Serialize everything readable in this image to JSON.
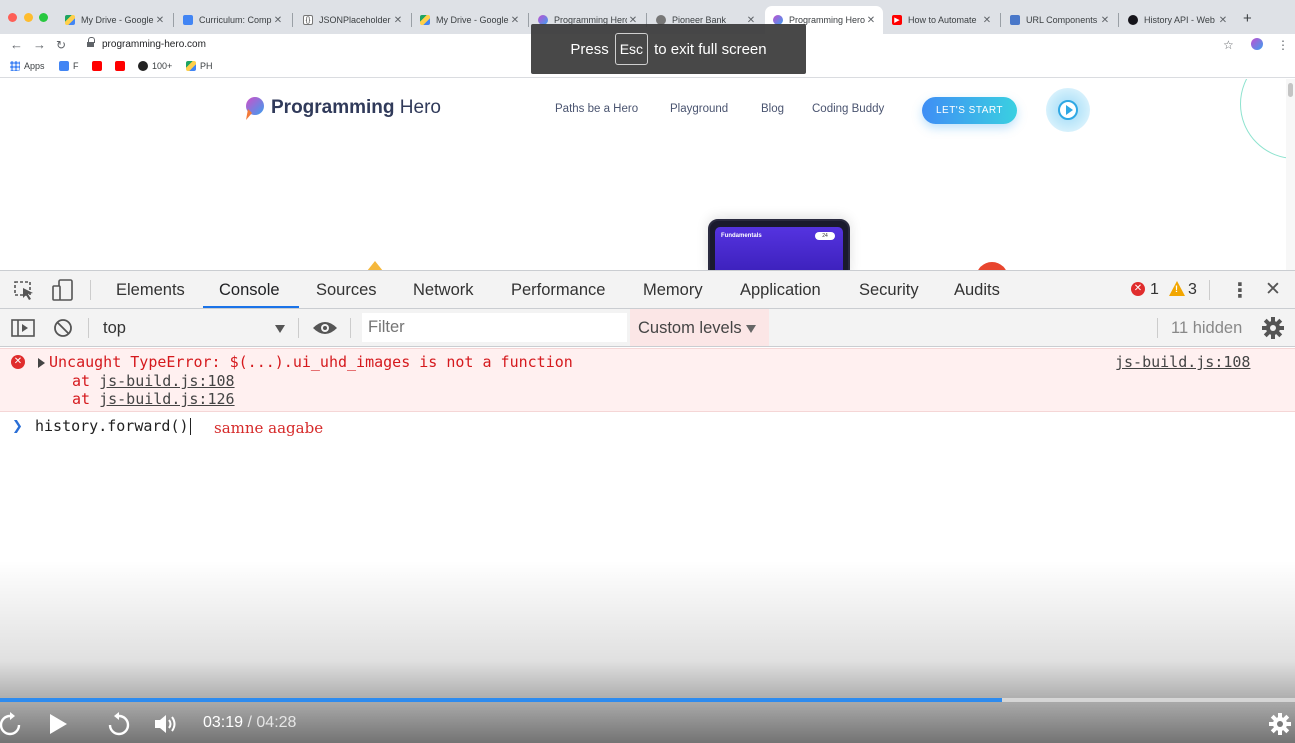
{
  "browser": {
    "tabs": [
      {
        "label": "My Drive - Google",
        "favicon": "google-drive-icon",
        "active": false
      },
      {
        "label": "Curriculum: Compl",
        "favicon": "google-docs-icon",
        "active": false
      },
      {
        "label": "JSONPlaceholder",
        "favicon": "jsonplaceholder-icon",
        "active": false
      },
      {
        "label": "My Drive - Google",
        "favicon": "google-drive-icon",
        "active": false
      },
      {
        "label": "Programming Hero",
        "favicon": "programming-hero-icon",
        "active": false
      },
      {
        "label": "Pioneer Bank",
        "favicon": "globe-icon",
        "active": false
      },
      {
        "label": "Programming Hero",
        "favicon": "programming-hero-icon",
        "active": true
      },
      {
        "label": "How to Automate",
        "favicon": "youtube-icon",
        "active": false
      },
      {
        "label": "URL Components",
        "favicon": "url-components-icon",
        "active": false
      },
      {
        "label": "History API - Web",
        "favicon": "mdn-icon",
        "active": false
      }
    ],
    "url": "programming-hero.com",
    "bookmarks": [
      "Apps",
      "F",
      "",
      "",
      "100+",
      "PH"
    ],
    "fullscreen_notice": {
      "before": "Press",
      "key": "Esc",
      "after": "to exit full screen"
    }
  },
  "site": {
    "logo_bold": "Programming",
    "logo_rest": " Hero",
    "nav": [
      "Paths be a Hero",
      "Playground",
      "Blog",
      "Coding Buddy"
    ],
    "cta": "LET'S START",
    "phone": {
      "title": "Fundamentals",
      "badge": "24"
    }
  },
  "devtools": {
    "tabs": [
      "Elements",
      "Console",
      "Sources",
      "Network",
      "Performance",
      "Memory",
      "Application",
      "Security",
      "Audits"
    ],
    "active_tab": "Console",
    "error_count": "1",
    "warning_count": "3",
    "context": "top",
    "filter_placeholder": "Filter",
    "levels": "Custom levels",
    "hidden": "11 hidden",
    "error": {
      "message": "Uncaught TypeError: $(...).ui_uhd_images is not a function",
      "at_prefix": "at ",
      "stack": [
        "js-build.js:108",
        "js-build.js:126"
      ],
      "source": "js-build.js:108"
    },
    "prompt_input": "history.forward()",
    "annotation": "samne aagabe"
  },
  "player": {
    "current_time": "03:19",
    "separator": " / ",
    "duration": "04:28",
    "progress": 0.774
  },
  "colors": {
    "accent": "#1a73e8",
    "error": "#d5191d",
    "progress": "#2d8bef",
    "cta_start": "#3f8ef5",
    "cta_end": "#3ad0e1"
  }
}
